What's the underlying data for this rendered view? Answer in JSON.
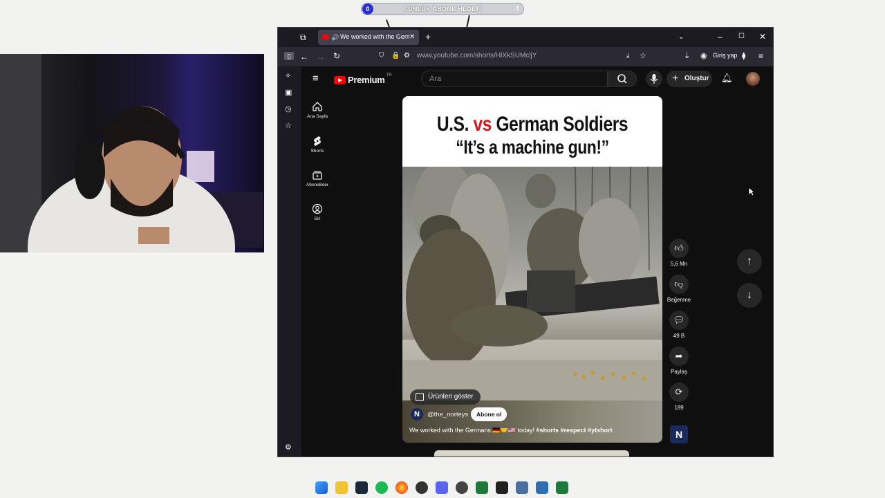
{
  "overlay": {
    "goal_label": "GÜNLÜK ABONE HEDEFİ",
    "goal_current": "0",
    "goal_target": "1"
  },
  "browser": {
    "tab_title": "We worked with the Germans",
    "url": "www.youtube.com/shorts/HlXkSUMcljY",
    "signin_label": "Giriş yap"
  },
  "youtube": {
    "logo_text": "Premium",
    "logo_region": "TR",
    "search_placeholder": "Ara",
    "create_label": "Oluştur",
    "nav": [
      {
        "label": "Ana Sayfa",
        "icon": "home-icon"
      },
      {
        "label": "Shorts",
        "icon": "shorts-icon"
      },
      {
        "label": "Abonelikler",
        "icon": "subscriptions-icon"
      },
      {
        "label": "Siz",
        "icon": "you-icon"
      }
    ]
  },
  "short": {
    "headline_us": "U.S.",
    "headline_vs": "vs",
    "headline_german": "German Soldiers",
    "headline_line2": "“It’s a machine gun!”",
    "products_label": "Ürünleri göster",
    "channel_name": "@the_norteys",
    "subscribe_label": "Abone ol",
    "caption_text": "We worked with the Germans 🇩🇪🤝🇺🇸 today!",
    "caption_tags": "#shorts #respect #ytshort"
  },
  "actions": {
    "likes": "5,6 Mn",
    "dislike_label": "Beğenme",
    "comments": "49 B",
    "share_label": "Paylaş",
    "remix_count": "189"
  },
  "colors": {
    "yt_red": "#ff0000",
    "headline_red": "#d11b1b",
    "dark_bg": "#0f0f0f",
    "firefox_chrome": "#2b2a33"
  }
}
